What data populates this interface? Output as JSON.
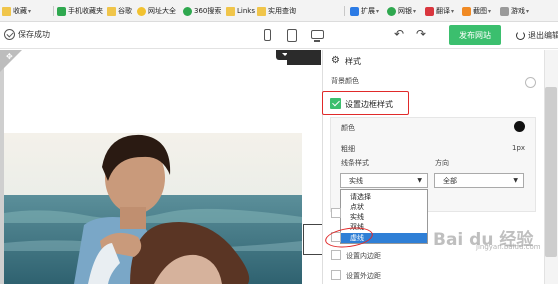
{
  "bookmarks_bar": {
    "items": [
      {
        "label": "收藏",
        "icon": "star-folder-icon"
      },
      {
        "label": "手机收藏夹",
        "icon": "phone-folder-icon"
      },
      {
        "label": "谷歌",
        "icon": "folder-icon"
      },
      {
        "label": "网址大全",
        "icon": "site-nav-icon"
      },
      {
        "label": "360搜索",
        "icon": "360-search-icon"
      },
      {
        "label": "Links",
        "icon": "folder-icon"
      },
      {
        "label": "实用查询",
        "icon": "folder-icon"
      }
    ],
    "right_items": [
      {
        "label": "扩展",
        "icon": "extension-icon"
      },
      {
        "label": "网银",
        "icon": "bank-icon"
      },
      {
        "label": "翻译",
        "icon": "translate-icon"
      },
      {
        "label": "截图",
        "icon": "screenshot-icon"
      },
      {
        "label": "游戏",
        "icon": "game-icon"
      }
    ]
  },
  "toolbar": {
    "saved_label": "保存成功",
    "publish_label": "发布网站",
    "exit_label": "退出编辑",
    "publish_color": "#3bbf6e"
  },
  "panel": {
    "section_title": "样式",
    "bg_color_label": "背景颜色",
    "border_style_checkbox": {
      "label": "设置边框样式",
      "checked": true
    },
    "color_label": "颜色",
    "thickness_label": "粗细",
    "thickness_value": "1px",
    "line_style_label": "线条样式",
    "direction_label": "方向",
    "line_style_value": "实线",
    "direction_value": "全部",
    "line_style_options": [
      "请选择",
      "点状",
      "实线",
      "双线",
      "虚线"
    ],
    "line_style_highlighted": "虚线",
    "inner_margin_label": "设置内边距",
    "outer_margin_label": "设置外边距",
    "border_color": "#111111"
  },
  "watermark": {
    "text": "Bai du 经验",
    "sub": "jingyan.baidu.com"
  },
  "annotation_color": "#e02a2a"
}
